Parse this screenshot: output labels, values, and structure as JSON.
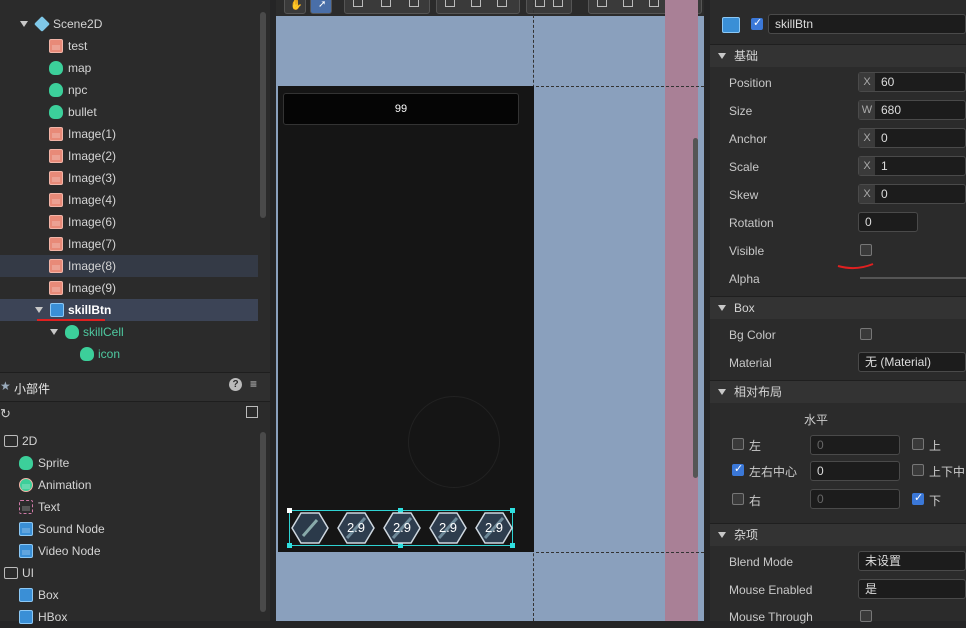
{
  "hierarchy": {
    "scene": "Scene2D",
    "items": [
      {
        "label": "test",
        "icon": "image-icon"
      },
      {
        "label": "map",
        "icon": "sprite-icon"
      },
      {
        "label": "npc",
        "icon": "sprite-icon"
      },
      {
        "label": "bullet",
        "icon": "sprite-icon"
      },
      {
        "label": "Image(1)",
        "icon": "image-icon"
      },
      {
        "label": "Image(2)",
        "icon": "image-icon"
      },
      {
        "label": "Image(3)",
        "icon": "image-icon"
      },
      {
        "label": "Image(4)",
        "icon": "image-icon"
      },
      {
        "label": "Image(6)",
        "icon": "image-icon"
      },
      {
        "label": "Image(7)",
        "icon": "image-icon"
      },
      {
        "label": "Image(8)",
        "icon": "image-icon"
      },
      {
        "label": "Image(9)",
        "icon": "image-icon"
      }
    ],
    "selected": "skillBtn",
    "child": "skillCell",
    "grandchild": "icon"
  },
  "widgets": {
    "title": "小部件",
    "groups": [
      {
        "label": "2D",
        "items": [
          "Sprite",
          "Animation",
          "Text",
          "Sound Node",
          "Video Node"
        ]
      },
      {
        "label": "UI",
        "items": [
          "Box",
          "HBox"
        ]
      }
    ]
  },
  "scene_view": {
    "score": "99",
    "skill_values": [
      "2.9",
      "2.9",
      "2.9",
      "2.9"
    ]
  },
  "inspector": {
    "node_name": "skillBtn",
    "section_basic": "基础",
    "position": {
      "label": "Position",
      "axis": "X",
      "value": "60"
    },
    "size": {
      "label": "Size",
      "axis": "W",
      "value": "680"
    },
    "anchor": {
      "label": "Anchor",
      "axis": "X",
      "value": "0"
    },
    "scale": {
      "label": "Scale",
      "axis": "X",
      "value": "1"
    },
    "skew": {
      "label": "Skew",
      "axis": "X",
      "value": "0"
    },
    "rotation": {
      "label": "Rotation",
      "value": "0"
    },
    "visible": {
      "label": "Visible",
      "checked": false
    },
    "alpha": {
      "label": "Alpha"
    },
    "section_box": "Box",
    "bg_color": {
      "label": "Bg Color"
    },
    "material": {
      "label": "Material",
      "value": "无 (Material)"
    },
    "section_layout": "相对布局",
    "horizontal": "水平",
    "left": {
      "label": "左",
      "value": "0"
    },
    "center": {
      "label": "左右中心",
      "value": "0"
    },
    "right": {
      "label": "右",
      "value": "0"
    },
    "top": {
      "label": "上"
    },
    "middle": {
      "label": "上下中"
    },
    "bottom": {
      "label": "下"
    },
    "section_misc": "杂项",
    "blend_mode": {
      "label": "Blend Mode",
      "value": "未设置"
    },
    "mouse_enabled": {
      "label": "Mouse Enabled",
      "value": "是"
    },
    "mouse_through": {
      "label": "Mouse Through"
    }
  },
  "colors": {
    "accent": "#3b78d8",
    "selection": "#2fd3d3",
    "annotation": "#e02020"
  }
}
